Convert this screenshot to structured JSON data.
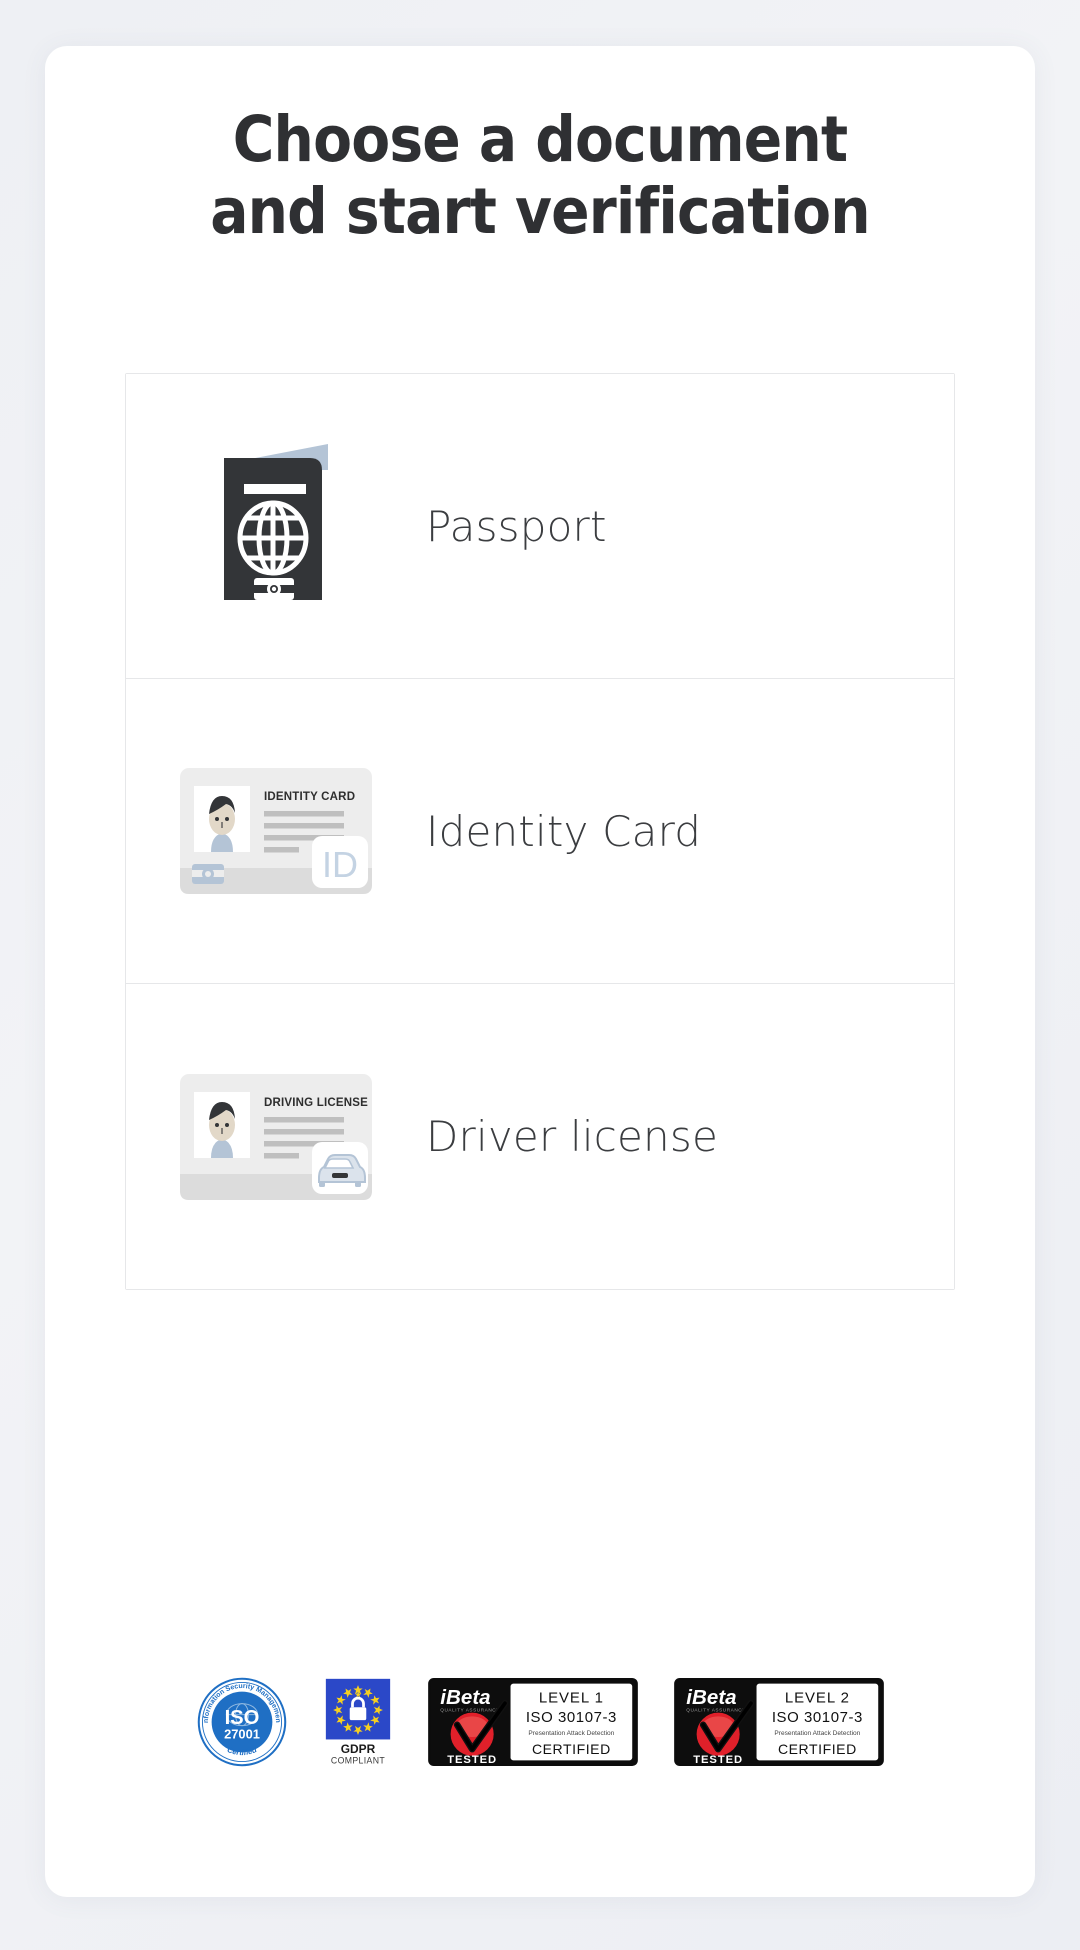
{
  "page": {
    "background_color": "#f0f1f5",
    "card_background": "#ffffff"
  },
  "heading": {
    "line1": "Choose a document",
    "line2": "and start verification",
    "color": "#2f3033"
  },
  "options": [
    {
      "id": "passport",
      "label": "Passport",
      "icon": "passport-icon",
      "icon_colors": {
        "cover": "#333538",
        "page": "#b4c4d6",
        "detail": "#ffffff"
      }
    },
    {
      "id": "identity-card",
      "label": "Identity Card",
      "icon": "identity-card-icon",
      "card_title": "IDENTITY CARD",
      "card_badge_text": "ID",
      "icon_colors": {
        "card": "#ededed",
        "stripe": "#dcdcdc",
        "lines": "#bfbfbf",
        "hair": "#333538",
        "skin": "#e2d8c8",
        "shirt": "#b4c4d6",
        "badge": "#c4d3e3"
      }
    },
    {
      "id": "driver-license",
      "label": "Driver license",
      "icon": "driving-license-icon",
      "card_title": "DRIVING LICENSE",
      "card_badge_text": "car",
      "icon_colors": {
        "card": "#ededed",
        "stripe": "#dcdcdc",
        "lines": "#bfbfbf",
        "hair": "#333538",
        "skin": "#e2d8c8",
        "shirt": "#b4c4d6",
        "badge": "#c4d3e3"
      }
    }
  ],
  "badges": [
    {
      "id": "iso-27001",
      "type": "iso-seal",
      "ring_text_top": "Information Security Management",
      "ring_text_bottom": "Certified",
      "main_text": "ISO",
      "number_text": "27001",
      "color": "#1f6fc4"
    },
    {
      "id": "gdpr",
      "type": "gdpr-seal",
      "title": "GDPR",
      "subtitle": "COMPLIANT",
      "flag_color": "#2b48c8",
      "star_color": "#f5cf20",
      "lock_color": "#ffffff"
    },
    {
      "id": "ibeta-level-1",
      "type": "ibeta-seal",
      "brand": "iBeta",
      "brand_sub": "QUALITY ASSURANCE",
      "tested_text": "TESTED",
      "level_text": "LEVEL 1",
      "standard_text": "ISO 30107-3",
      "description_text": "Presentation Attack Detection",
      "certified_text": "CERTIFIED",
      "accent_color": "#e0202a"
    },
    {
      "id": "ibeta-level-2",
      "type": "ibeta-seal",
      "brand": "iBeta",
      "brand_sub": "QUALITY ASSURANCE",
      "tested_text": "TESTED",
      "level_text": "LEVEL 2",
      "standard_text": "ISO 30107-3",
      "description_text": "Presentation Attack Detection",
      "certified_text": "CERTIFIED",
      "accent_color": "#e0202a"
    }
  ]
}
